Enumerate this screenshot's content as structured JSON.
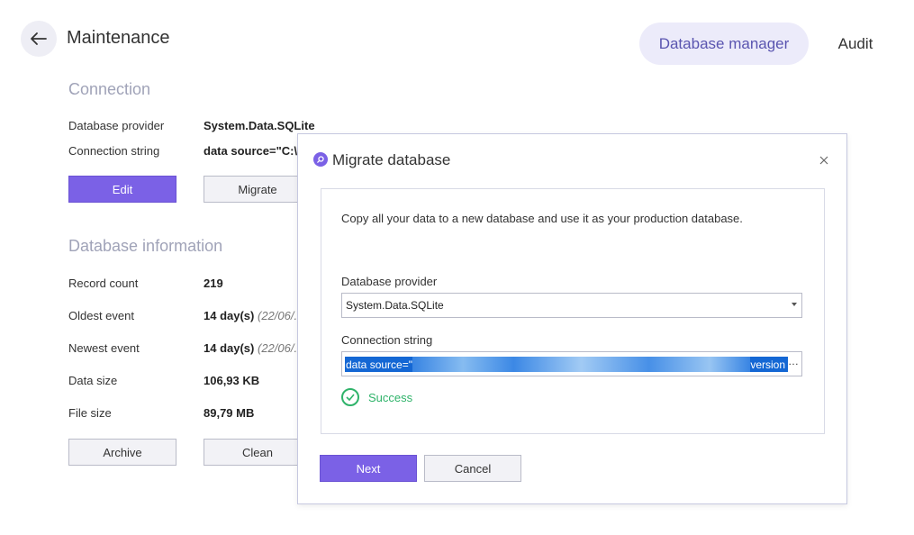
{
  "header": {
    "title": "Maintenance",
    "tabs": [
      {
        "label": "Database manager",
        "active": true
      },
      {
        "label": "Audit",
        "active": false
      }
    ]
  },
  "connection": {
    "section_title": "Connection",
    "provider_label": "Database provider",
    "provider_value": "System.Data.SQLite",
    "conn_label": "Connection string",
    "conn_value": "data source=\"C:\\",
    "edit_button": "Edit",
    "migrate_button": "Migrate"
  },
  "db_info": {
    "section_title": "Database information",
    "rows": [
      {
        "label": "Record count",
        "value": "219",
        "extra": ""
      },
      {
        "label": "Oldest event",
        "value": "14 day(s)",
        "extra": "(22/06/..."
      },
      {
        "label": "Newest event",
        "value": "14 day(s)",
        "extra": "(22/06/..."
      },
      {
        "label": "Data size",
        "value": "106,93 KB",
        "extra": ""
      },
      {
        "label": "File size",
        "value": "89,79 MB",
        "extra": ""
      }
    ],
    "archive_button": "Archive",
    "clean_button": "Clean"
  },
  "dialog": {
    "title": "Migrate database",
    "description": "Copy all your data to a new database and use it as your production database.",
    "provider_label": "Database provider",
    "provider_value": "System.Data.SQLite",
    "conn_label": "Connection string",
    "conn_value_start": "data source=\"",
    "conn_value_end": "version",
    "conn_more": "…",
    "status_text": "Success",
    "next_button": "Next",
    "cancel_button": "Cancel"
  },
  "colors": {
    "accent": "#7b61e6",
    "success": "#2fb36a",
    "selection": "#1467d4"
  }
}
